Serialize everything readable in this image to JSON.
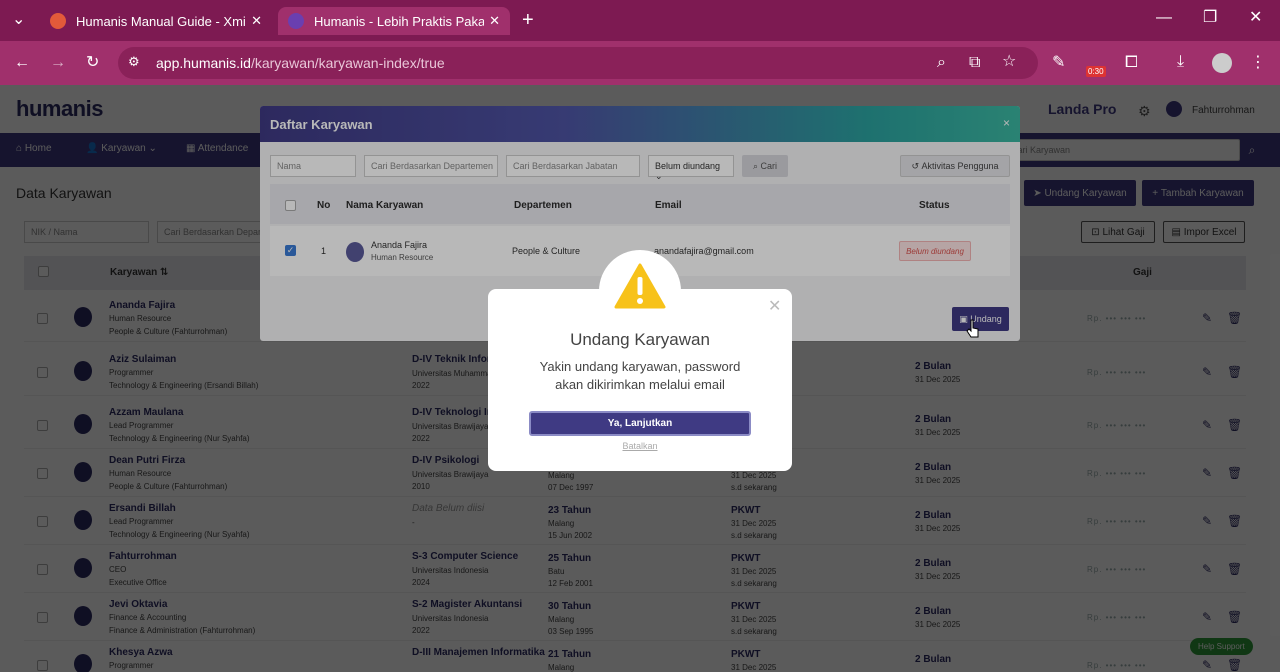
{
  "browser": {
    "tabs": [
      {
        "title": "Humanis Manual Guide - Xmind",
        "active": false
      },
      {
        "title": "Humanis - Lebih Praktis Pakai HRIS",
        "active": true
      }
    ],
    "url_host": "app.humanis.id",
    "url_path": "/karyawan/karyawan-index/true",
    "extension_badge": "0:30"
  },
  "app": {
    "logo": "humanis",
    "company": "Landa Pro",
    "user": "Fahturrohman",
    "nav": [
      "Home",
      "Karyawan",
      "Attendance"
    ],
    "search_placeholder": "Cari Karyawan",
    "page_title": "Data Karyawan",
    "buttons": {
      "undang": "Undang Karyawan",
      "tambah": "Tambah Karyawan",
      "lihat_gaji": "Lihat Gaji",
      "impor": "Impor Excel"
    },
    "filters": {
      "nik": "NIK / Nama",
      "dept": "Cari Berdasarkan Departemen"
    },
    "columns": {
      "karyawan": "Karyawan",
      "gaji": "Gaji"
    },
    "rows": [
      {
        "name": "Ananda Fajira",
        "role": "Human Resource",
        "dept": "People & Culture (Fahturrohman)",
        "edu": "",
        "edu_sub": "",
        "edu_year": "",
        "age": "",
        "age_city": "",
        "age_dob": "",
        "contract": "",
        "contract_from": "",
        "contract_to": "",
        "dur": "",
        "dur_date": "",
        "gaji": "Rp. ••• ••• •••"
      },
      {
        "name": "Aziz Sulaiman",
        "role": "Programmer",
        "dept": "Technology & Engineering (Ersandi Billah)",
        "edu": "D-IV Teknik Informatika",
        "edu_sub": "Universitas Muhammadiyah",
        "edu_city": "Malang",
        "edu_year": "2022",
        "age": "",
        "age_city": "",
        "age_dob": "",
        "contract": "",
        "contract_from": "",
        "contract_to": "",
        "dur": "2 Bulan",
        "dur_date": "31 Dec 2025",
        "gaji": "Rp. ••• ••• •••"
      },
      {
        "name": "Azzam Maulana",
        "role": "Lead Programmer",
        "dept": "Technology & Engineering (Nur Syahfa)",
        "edu": "D-IV Teknologi Informasi",
        "edu_sub": "Universitas Brawijaya",
        "edu_year": "2022",
        "age": "",
        "age_city": "",
        "age_dob": "",
        "contract": "",
        "contract_from": "",
        "contract_to": "",
        "dur": "2 Bulan",
        "dur_date": "31 Dec 2025",
        "gaji": "Rp. ••• ••• •••"
      },
      {
        "name": "Dean Putri Firza",
        "role": "Human Resource",
        "dept": "People & Culture (Fahturrohman)",
        "edu": "D-IV Psikologi",
        "edu_sub": "Universitas Brawijaya",
        "edu_year": "2010",
        "age": "",
        "age_city": "Malang",
        "age_dob": "07 Dec 1997",
        "contract": "",
        "contract_from": "31 Dec 2025",
        "contract_to": "s.d sekarang",
        "dur": "2 Bulan",
        "dur_date": "31 Dec 2025",
        "gaji": "Rp. ••• ••• •••"
      },
      {
        "name": "Ersandi Billah",
        "role": "Lead Programmer",
        "dept": "Technology & Engineering (Nur Syahfa)",
        "edu": "Data Belum diisi",
        "edu_sub": "-",
        "edu_year": "",
        "age": "23 Tahun",
        "age_city": "Malang",
        "age_dob": "15 Jun 2002",
        "contract": "PKWT",
        "contract_from": "31 Dec 2025",
        "contract_to": "s.d sekarang",
        "dur": "2 Bulan",
        "dur_date": "31 Dec 2025",
        "gaji": "Rp. ••• ••• •••"
      },
      {
        "name": "Fahturrohman",
        "role": "CEO",
        "dept": "Executive Office",
        "edu": "S-3 Computer Science",
        "edu_sub": "Universitas Indonesia",
        "edu_year": "2024",
        "age": "25 Tahun",
        "age_city": "Batu",
        "age_dob": "12 Feb 2001",
        "contract": "PKWT",
        "contract_from": "31 Dec 2025",
        "contract_to": "s.d sekarang",
        "dur": "2 Bulan",
        "dur_date": "31 Dec 2025",
        "gaji": "Rp. ••• ••• •••"
      },
      {
        "name": "Jevi Oktavia",
        "role": "Finance & Accounting",
        "dept": "Finance & Administration (Fahturrohman)",
        "edu": "S-2 Magister Akuntansi",
        "edu_sub": "Universitas Indonesia",
        "edu_year": "2022",
        "age": "30 Tahun",
        "age_city": "Malang",
        "age_dob": "03 Sep 1995",
        "contract": "PKWT",
        "contract_from": "31 Dec 2025",
        "contract_to": "s.d sekarang",
        "dur": "2 Bulan",
        "dur_date": "31 Dec 2025",
        "gaji": "Rp. ••• ••• •••"
      },
      {
        "name": "Khesya Azwa",
        "role": "Programmer",
        "dept": "",
        "edu": "D-III Manajemen Informatika",
        "edu_sub": "",
        "edu_year": "",
        "age": "21 Tahun",
        "age_city": "Malang",
        "age_dob": "",
        "contract": "PKWT",
        "contract_from": "31 Dec 2025",
        "contract_to": "",
        "dur": "2 Bulan",
        "dur_date": "",
        "gaji": "Rp. ••• ••• •••"
      }
    ],
    "help": "Help Support"
  },
  "modal": {
    "title": "Daftar Karyawan",
    "close": "×",
    "filters": {
      "nama": "Nama",
      "dept": "Cari Berdasarkan Departemen",
      "jabatan": "Cari Berdasarkan Jabatan",
      "status": "Belum diundang",
      "cari": "Cari",
      "aktivitas": "Aktivitas Pengguna"
    },
    "columns": {
      "no": "No",
      "nama": "Nama Karyawan",
      "dept": "Departemen",
      "email": "Email",
      "status": "Status"
    },
    "row": {
      "no": "1",
      "name": "Ananda Fajira",
      "role": "Human Resource",
      "dept": "People & Culture",
      "email": "anandafajira@gmail.com",
      "status": "Belum diundang"
    },
    "undang": "Undang"
  },
  "alert": {
    "title": "Undang Karyawan",
    "line1": "Yakin undang karyawan, password",
    "line2": "akan dikirimkan melalui email",
    "confirm": "Ya, Lanjutkan",
    "cancel": "Batalkan"
  }
}
